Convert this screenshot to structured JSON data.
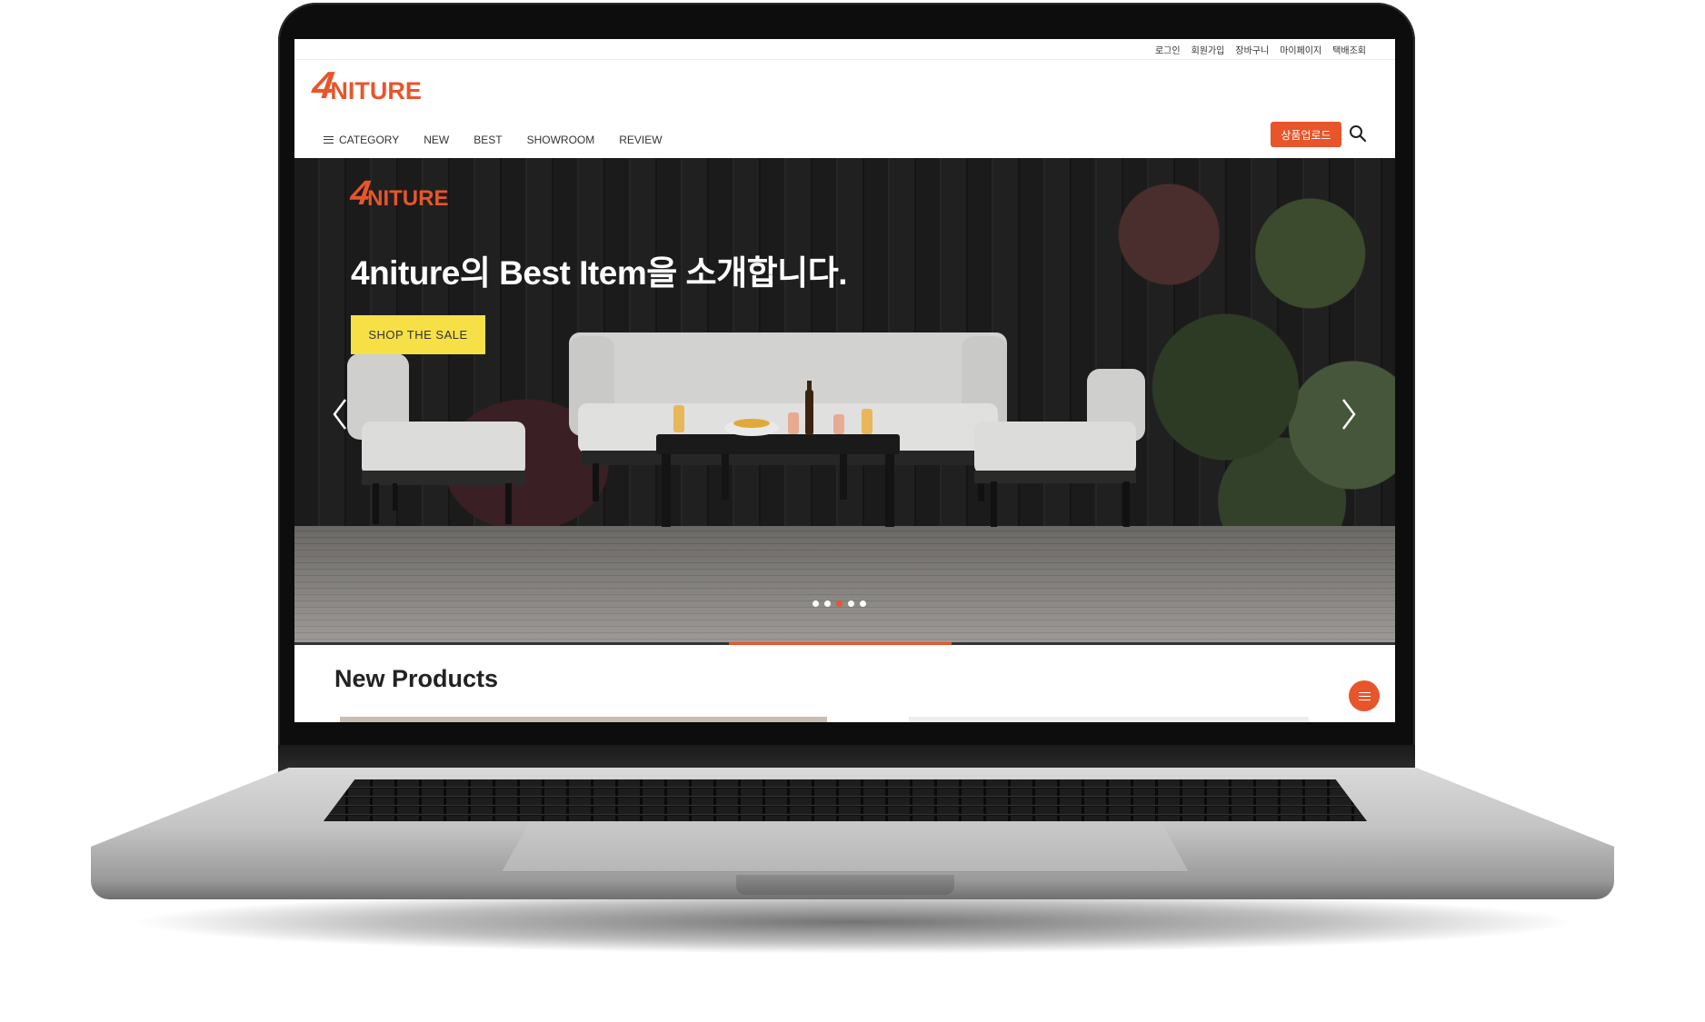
{
  "utility_links": [
    "로그인",
    "회원가입",
    "장바구니",
    "마이페이지",
    "택배조회"
  ],
  "logo": {
    "mark": "4",
    "word": "NITURE"
  },
  "nav": {
    "category": "CATEGORY",
    "items": [
      "NEW",
      "BEST",
      "SHOWROOM",
      "REVIEW"
    ]
  },
  "upload_button": "상품업로드",
  "hero": {
    "logo_mark": "4",
    "logo_word": "NITURE",
    "title": "4niture의 Best Item을 소개합니다.",
    "cta": "SHOP THE SALE",
    "slide_count": 5,
    "active_slide": 3
  },
  "section": {
    "title": "New Products"
  },
  "colors": {
    "accent": "#e8552a",
    "cta": "#f7e046"
  },
  "icons": [
    "menu-icon",
    "search-icon",
    "chevron-left-icon",
    "chevron-right-icon",
    "floating-menu-icon"
  ]
}
